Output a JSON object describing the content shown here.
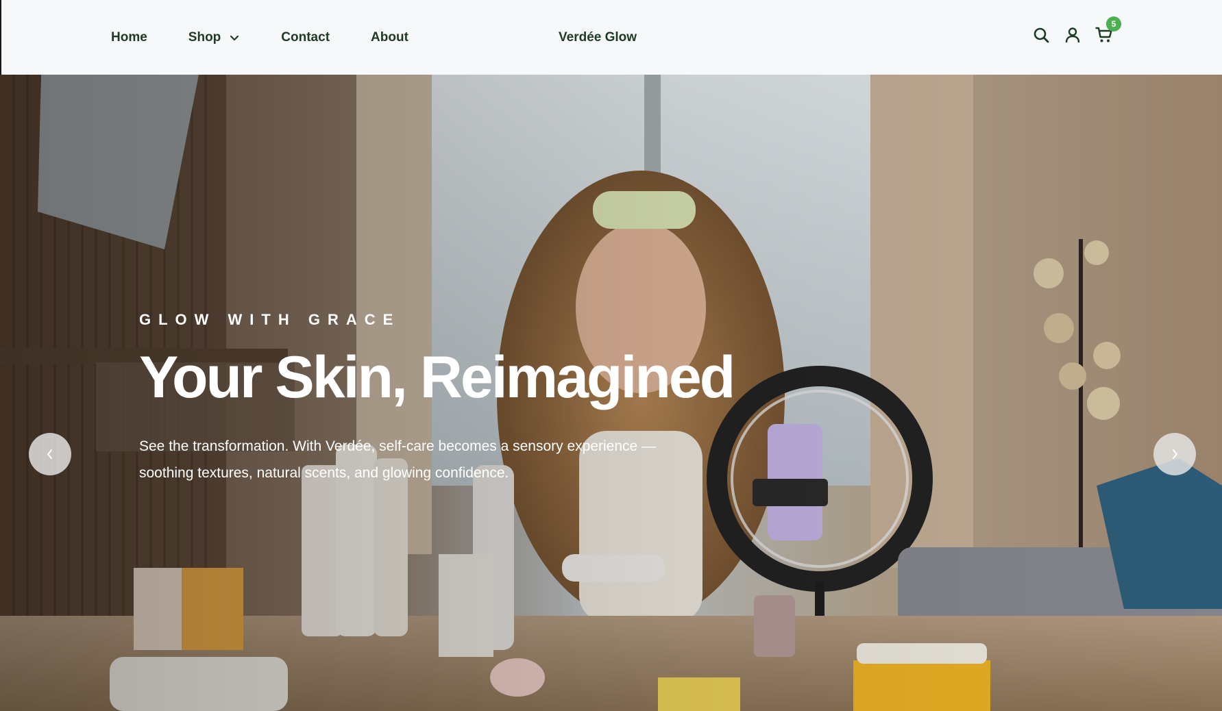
{
  "header": {
    "nav": {
      "home": "Home",
      "shop": "Shop",
      "contact": "Contact",
      "about": "About"
    },
    "brand": "Verdée Glow",
    "icons": [
      "search-icon",
      "user-icon",
      "cart-icon"
    ],
    "cart_count": "5",
    "text_color": "#1d3b24",
    "badge_color": "#4caf50"
  },
  "hero": {
    "eyebrow": "GLOW WITH GRACE",
    "headline": "Your Skin, Reimagined",
    "description": "See the transformation. With Verdée, self-care becomes a sensory experience — soothing textures, natural scents, and glowing confidence.",
    "prev_icon": "chevron-left-icon",
    "next_icon": "chevron-right-icon"
  }
}
